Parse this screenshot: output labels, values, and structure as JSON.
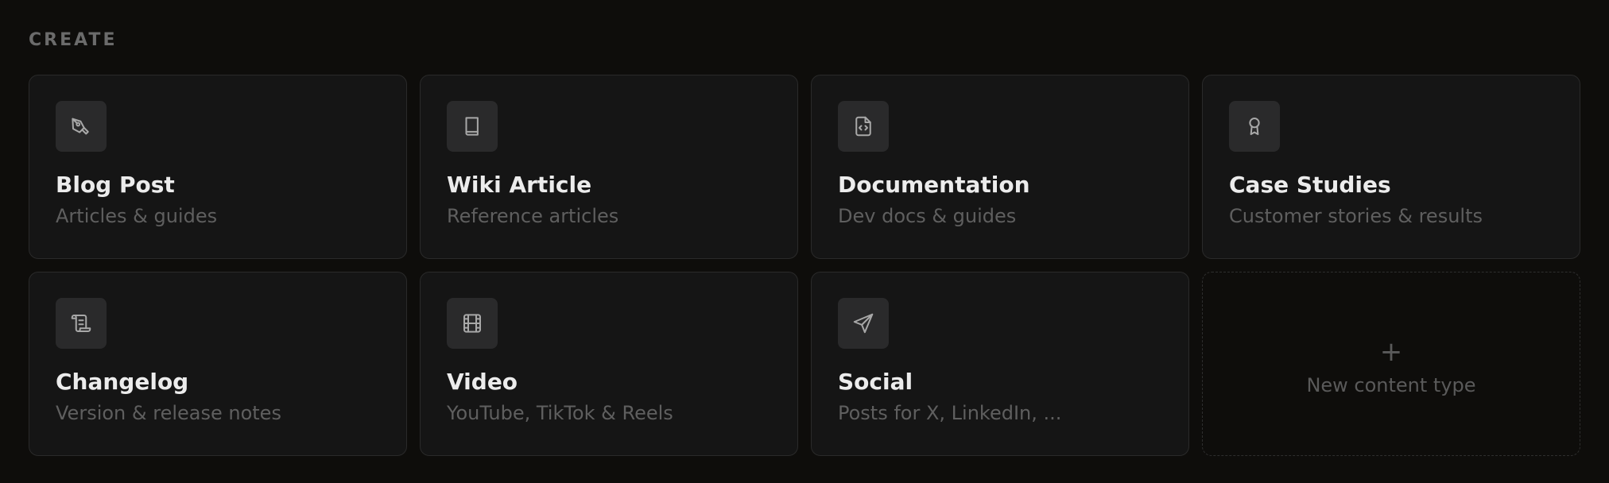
{
  "section": {
    "title": "CREATE"
  },
  "cards": [
    {
      "icon": "pen-nib-icon",
      "title": "Blog Post",
      "description": "Articles & guides"
    },
    {
      "icon": "book-icon",
      "title": "Wiki Article",
      "description": "Reference articles"
    },
    {
      "icon": "file-code-icon",
      "title": "Documentation",
      "description": "Dev docs & guides"
    },
    {
      "icon": "award-icon",
      "title": "Case Studies",
      "description": "Customer stories & results"
    },
    {
      "icon": "scroll-icon",
      "title": "Changelog",
      "description": "Version & release notes"
    },
    {
      "icon": "film-icon",
      "title": "Video",
      "description": "YouTube, TikTok & Reels"
    },
    {
      "icon": "send-icon",
      "title": "Social",
      "description": "Posts for X, LinkedIn, ..."
    }
  ],
  "new_card": {
    "plus": "+",
    "label": "New content type"
  },
  "colors": {
    "background": "#0e0d0b",
    "card": "#151515",
    "card_border": "#2a2a2a",
    "icon_box": "#2a2a2b",
    "title_text": "#ececec",
    "muted_text": "#5f5f5f"
  }
}
